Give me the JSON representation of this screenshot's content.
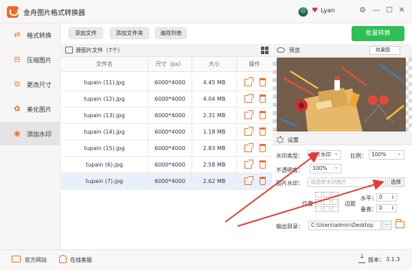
{
  "app": {
    "title": "金舟图片格式转换器",
    "username": "Lyan"
  },
  "window_controls": {
    "settings": "⚙",
    "minimize": "—",
    "maximize": "☐",
    "close": "✕"
  },
  "sidebar": {
    "items": [
      {
        "label": "格式转换",
        "icon": "⇄"
      },
      {
        "label": "压缩图片",
        "icon": "⊟"
      },
      {
        "label": "更改尺寸",
        "icon": "⧉"
      },
      {
        "label": "美化图片",
        "icon": "✿"
      },
      {
        "label": "添加水印",
        "icon": "◉"
      }
    ],
    "active_index": 4
  },
  "toolbar": {
    "add_file": "添加文件",
    "add_folder": "添加文件夹",
    "clear_list": "清除列表",
    "batch_convert": "批量转换"
  },
  "file_panel": {
    "title": "源图片文件（7个）",
    "columns": [
      "文件名",
      "尺寸（px）",
      "大小",
      "操作"
    ],
    "rows": [
      {
        "name": "tupain (11).jpg",
        "size_px": "6000*4000",
        "size": "4.45 MB"
      },
      {
        "name": "tupain (12).jpg",
        "size_px": "6000*4000",
        "size": "4.04 MB"
      },
      {
        "name": "tupain (13).jpg",
        "size_px": "6000*4000",
        "size": "2.31 MB"
      },
      {
        "name": "tupain (14).jpg",
        "size_px": "6000*4000",
        "size": "1.18 MB"
      },
      {
        "name": "tupain (15).jpg",
        "size_px": "6000*4000",
        "size": "2.83 MB"
      },
      {
        "name": "tupain (6).jpg",
        "size_px": "6000*4000",
        "size": "2.58 MB"
      },
      {
        "name": "tupain (7).jpg",
        "size_px": "6000*4000",
        "size": "2.62 MB"
      }
    ],
    "selected_index": 6
  },
  "preview": {
    "label": "预览",
    "effect_select": "效果图"
  },
  "settings": {
    "label": "设置",
    "watermark_type_label": "水印类型：",
    "watermark_type_value": "图片水印",
    "ratio_label": "比例：",
    "ratio_value": "100%",
    "opacity_label": "不透明度：",
    "opacity_value": "100%",
    "image_watermark_label": "图片水印：",
    "image_watermark_placeholder": "请选择水印图片",
    "choose_button": "选择",
    "position_label": "位置",
    "margin_label": "边距",
    "horizontal_label": "水平：",
    "horizontal_value": "0",
    "vertical_label": "垂直：",
    "vertical_value": "0",
    "output_dir_label": "输出目录：",
    "output_dir_value": "C:\\Users\\admin\\Desktop",
    "more_button": "···"
  },
  "footer": {
    "website": "官方网站",
    "support": "在线客服",
    "version_label": "版本：",
    "version_value": "3.1.3"
  },
  "colors": {
    "accent": "#f26a21",
    "batch_button": "#2ebf55",
    "arrow": "#e53935"
  }
}
